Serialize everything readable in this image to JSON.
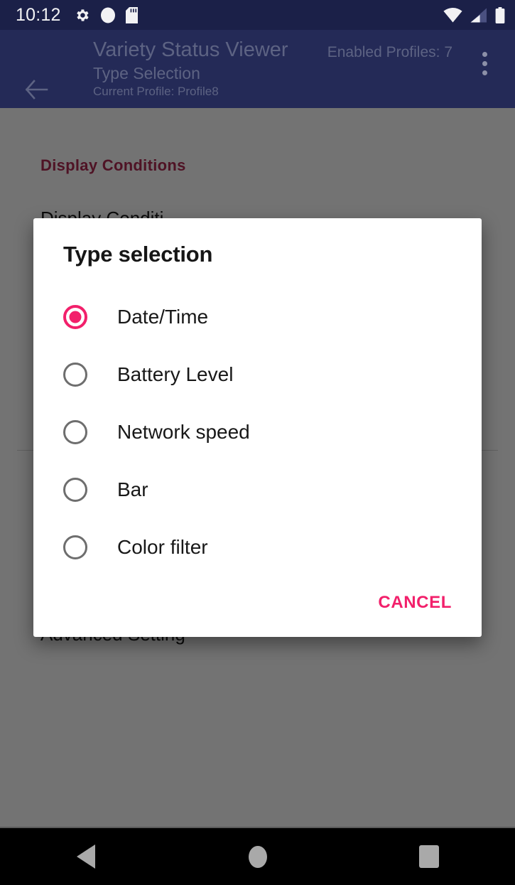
{
  "status_bar": {
    "clock": "10:12",
    "left_icons": [
      "gear-icon",
      "circle-icon",
      "sd-card-icon"
    ],
    "right_icons": [
      "wifi-icon",
      "cell-signal-icon",
      "battery-icon"
    ],
    "background_color": "#1b2048"
  },
  "toolbar": {
    "back_icon": "back-arrow-icon",
    "title": "Variety Status Viewer",
    "subtitle": "Type Selection",
    "profile_line": "Current Profile: Profile8",
    "enabled_profiles": "Enabled Profiles: 7",
    "overflow_icon": "overflow-menu-icon",
    "background_color": "#242a57",
    "text_color": "#5d6383"
  },
  "page": {
    "section_header": "Display Conditions",
    "rows": [
      "Display Conditi",
      "Advanced Setting"
    ],
    "header_color": "#b02a53"
  },
  "dialog": {
    "title": "Type selection",
    "accent_color": "#f2206b",
    "options": [
      {
        "label": "Date/Time",
        "selected": true
      },
      {
        "label": "Battery Level",
        "selected": false
      },
      {
        "label": "Network speed",
        "selected": false
      },
      {
        "label": "Bar",
        "selected": false
      },
      {
        "label": "Color filter",
        "selected": false
      }
    ],
    "cancel_label": "CANCEL"
  },
  "nav_bar": {
    "back_icon": "nav-back-icon",
    "home_icon": "nav-home-icon",
    "recents_icon": "nav-recents-icon"
  }
}
